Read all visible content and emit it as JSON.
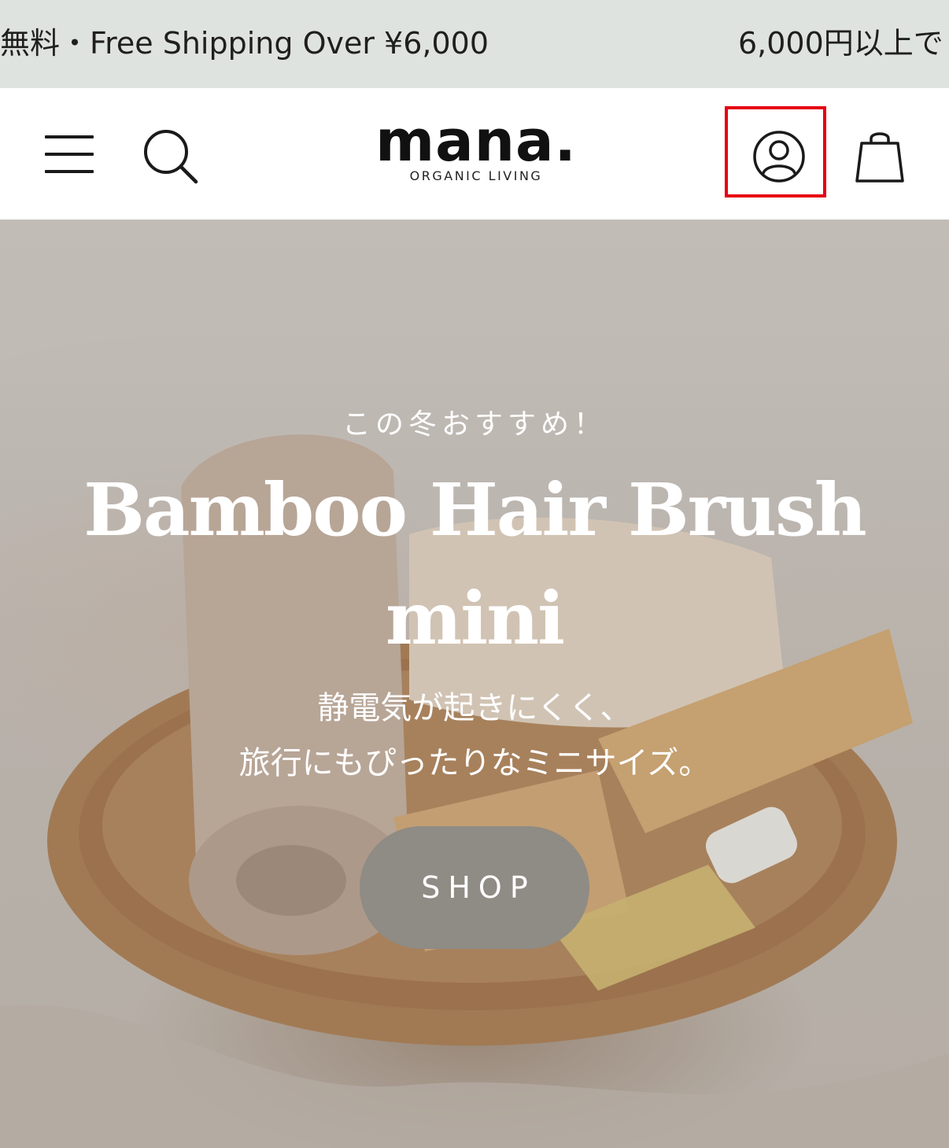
{
  "announcement": {
    "text_1": "無料・Free Shipping Over ¥6,000",
    "text_2": "6,000円以上で"
  },
  "header": {
    "logo_main": "mana.",
    "logo_sub": "ORGANIC LIVING",
    "icons": [
      "menu-icon",
      "search-icon",
      "account-icon",
      "cart-icon"
    ]
  },
  "hero": {
    "eyebrow": "この冬おすすめ！",
    "title_line_1": "Bamboo Hair Brush",
    "title_line_2": "mini",
    "subtitle_line_1": "静電気が起きにくく、",
    "subtitle_line_2": "旅行にもぴったりなミニサイズ。",
    "cta_label": "SHOP"
  },
  "colors": {
    "announcement_bg": "#dfe3df",
    "cta_bg": "#8f8b85",
    "highlight": "#e60012"
  }
}
